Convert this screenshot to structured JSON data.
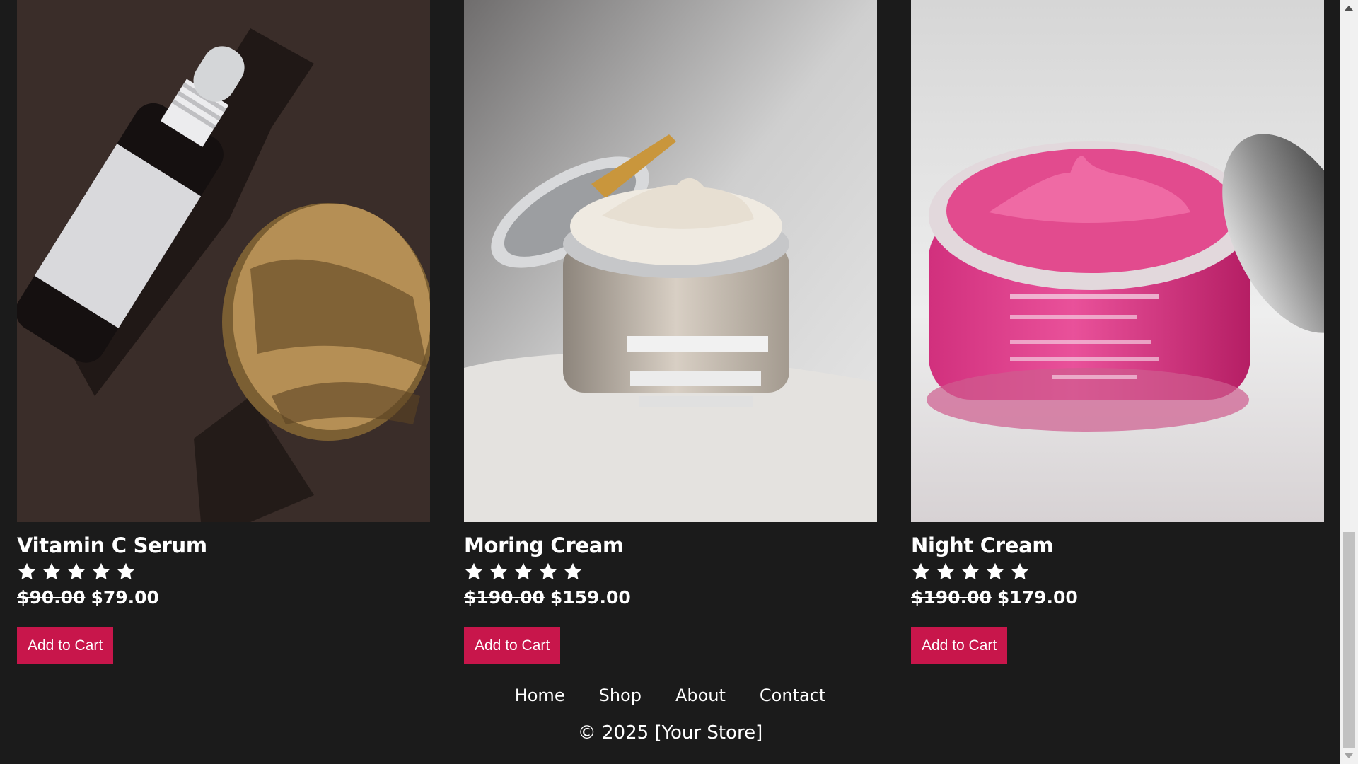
{
  "products": [
    {
      "name": "Vitamin C Serum",
      "rating": 5,
      "old_price": "$90.00",
      "price": "$79.00",
      "button_label": "Add to Cart"
    },
    {
      "name": "Moring Cream",
      "rating": 5,
      "old_price": "$190.00",
      "price": "$159.00",
      "button_label": "Add to Cart"
    },
    {
      "name": "Night Cream",
      "rating": 5,
      "old_price": "$190.00",
      "price": "$179.00",
      "button_label": "Add to Cart"
    }
  ],
  "footer": {
    "nav": [
      "Home",
      "Shop",
      "About",
      "Contact"
    ],
    "copyright": "© 2025 [Your Store]"
  },
  "colors": {
    "background": "#1b1b1b",
    "button": "#c8164b",
    "text": "#ffffff"
  }
}
